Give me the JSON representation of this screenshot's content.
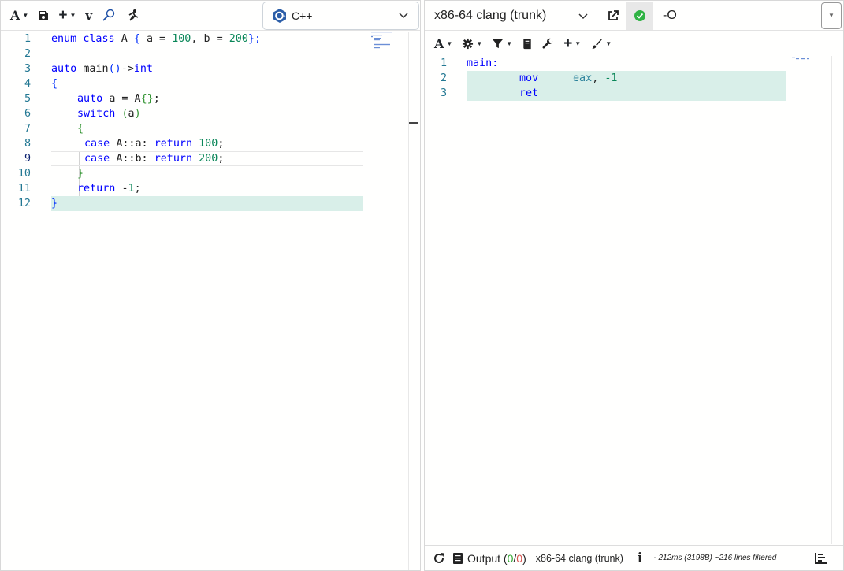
{
  "editor": {
    "toolbar": {
      "font_label": "A",
      "add_label": "+",
      "vim_label": "v"
    },
    "language": "C++",
    "lines": [
      {
        "n": "1"
      },
      {
        "n": "2"
      },
      {
        "n": "3"
      },
      {
        "n": "4"
      },
      {
        "n": "5"
      },
      {
        "n": "6"
      },
      {
        "n": "7"
      },
      {
        "n": "8"
      },
      {
        "n": "9"
      },
      {
        "n": "10"
      },
      {
        "n": "11"
      },
      {
        "n": "12"
      }
    ],
    "code": {
      "l1": [
        "enum",
        "class",
        "A",
        "{",
        "a = ",
        "100",
        ", b = ",
        "200",
        "};"
      ],
      "l3": [
        "auto",
        "main",
        "()",
        "->",
        "int"
      ],
      "l4": "{",
      "l5": [
        "auto",
        "a = A",
        "{}",
        ";"
      ],
      "l6": [
        "switch",
        "(",
        "a",
        ")"
      ],
      "l7": "{",
      "l8": [
        "case",
        "A::a: ",
        "return",
        "100",
        ";"
      ],
      "l9": [
        "case",
        "A::b: ",
        "return",
        "200",
        ";"
      ],
      "l10": "}",
      "l11": [
        "return",
        "-",
        "1",
        ";"
      ],
      "l12": "}"
    }
  },
  "compiler": {
    "name": "x86-64 clang (trunk)",
    "options": "-O",
    "toolbar": {
      "font_label": "A",
      "add_label": "+"
    },
    "asm_lines": [
      {
        "n": "1",
        "label": "main:"
      },
      {
        "n": "2",
        "op": "mov",
        "args_reg": "eax",
        ", ": ", ",
        "args_num": "-1"
      },
      {
        "n": "3",
        "op": "ret"
      }
    ],
    "status": {
      "output_label": "Output (",
      "stdout_count": "0",
      "slash": "/",
      "stderr_count": "0",
      "close": ")",
      "compiler_name": "x86-64 clang (trunk)",
      "info": "i",
      "timing": "- 212ms (3198B) ~216 lines filtered"
    }
  }
}
